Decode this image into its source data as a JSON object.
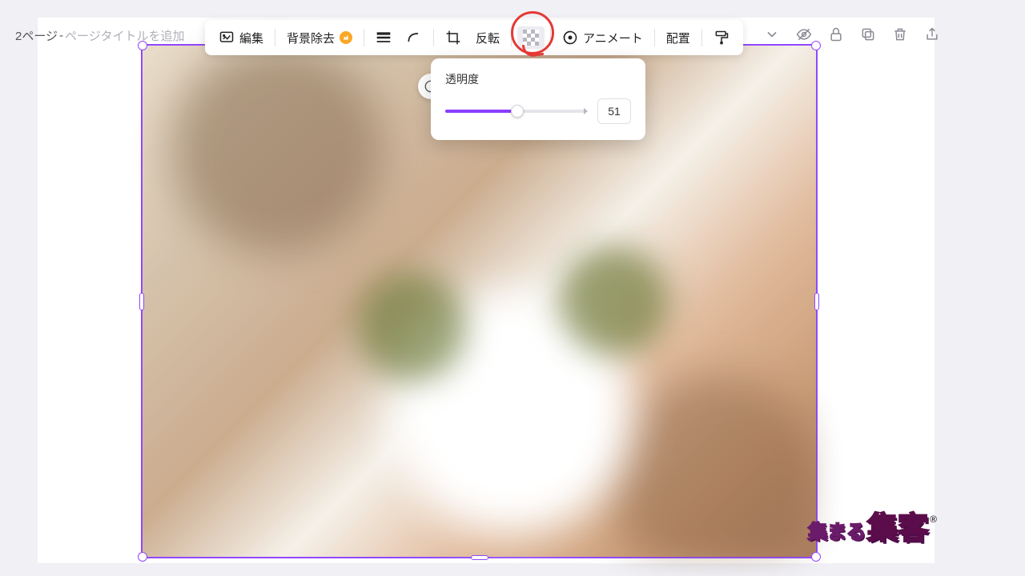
{
  "page_label": {
    "prefix": "2ページ",
    "sep": " - ",
    "placeholder": "ページタイトルを追加"
  },
  "toolbar": {
    "edit": "編集",
    "bg_remove": "背景除去",
    "flip": "反転",
    "animate": "アニメート",
    "position": "配置"
  },
  "popover": {
    "title": "透明度",
    "value": 51,
    "min": 0,
    "max": 100
  },
  "watermark": {
    "part1": "集まる",
    "part2": "集客",
    "reg": "®"
  },
  "colors": {
    "accent": "#8b3dff",
    "annotation": "#e53935"
  }
}
